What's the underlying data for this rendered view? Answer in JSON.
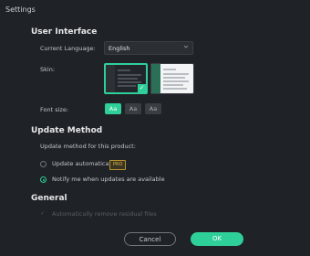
{
  "window": {
    "title": "Settings"
  },
  "user_interface": {
    "heading": "User Interface",
    "language_label": "Current Language:",
    "language_value": "English",
    "skin_label": "Skin:",
    "font_size_label": "Font size:",
    "font_sizes": [
      "Aa",
      "Aa",
      "Aa"
    ],
    "selected_font_index": 0
  },
  "update_method": {
    "heading": "Update Method",
    "subtitle": "Update method for this product:",
    "options": [
      {
        "label": "Update automatically",
        "badge": "PRO",
        "selected": false
      },
      {
        "label": "Notify me when updates are available",
        "selected": true
      }
    ]
  },
  "general": {
    "heading": "General",
    "first_option": "Automatically remove residual files"
  },
  "footer": {
    "cancel_label": "Cancel",
    "ok_label": "OK"
  },
  "colors": {
    "accent": "#2fcf9a",
    "background": "#1f2226",
    "pro_badge": "#e0b84a"
  },
  "icons": [
    "chevron-down-icon",
    "checkmark-icon"
  ]
}
